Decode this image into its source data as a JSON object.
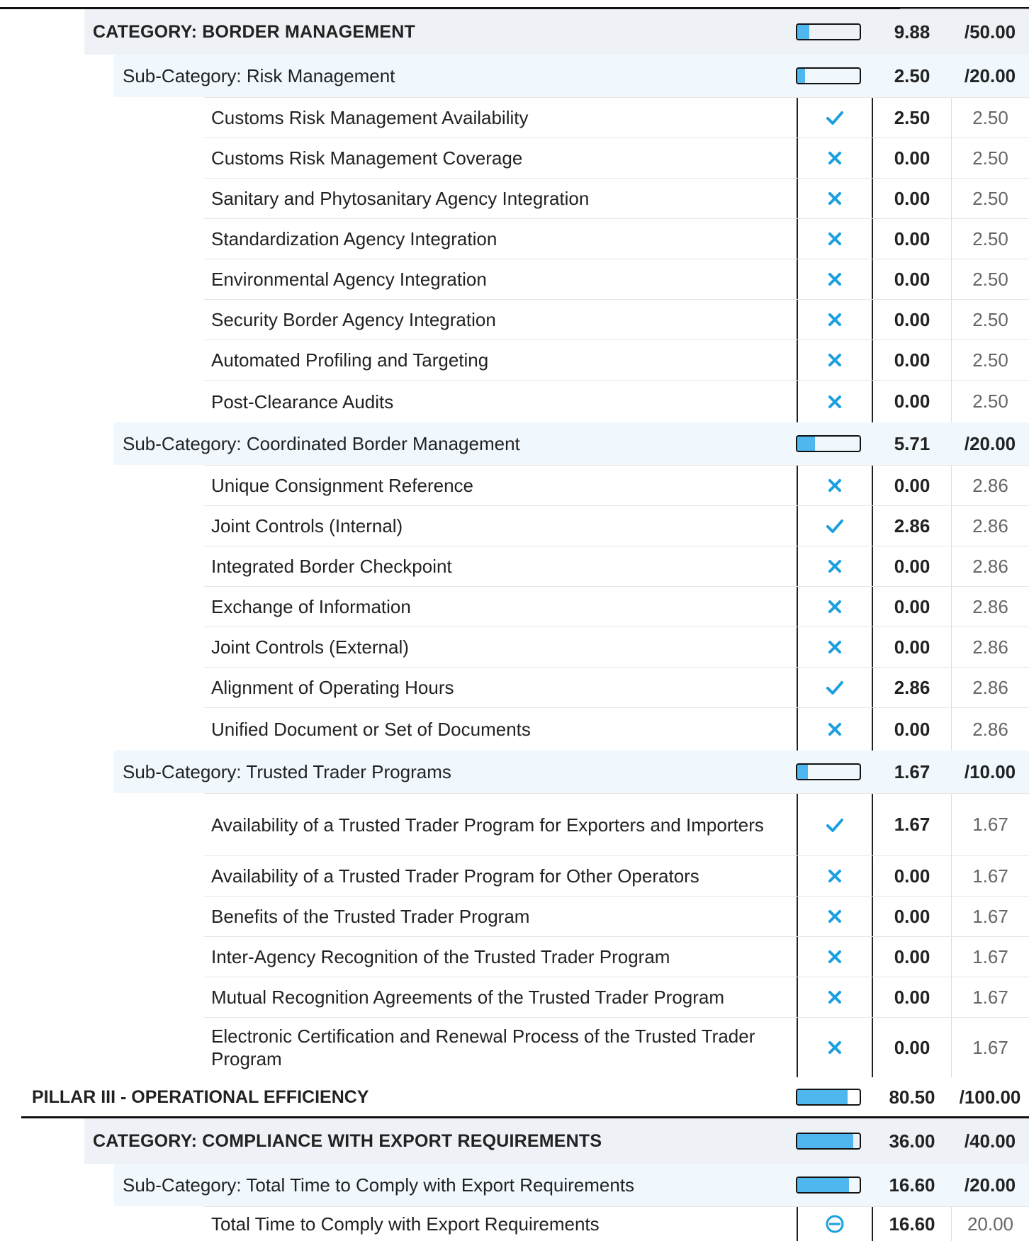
{
  "categories": [
    {
      "kind": "category",
      "label": "CATEGORY: BORDER MANAGEMENT",
      "score": "9.88",
      "max": "/50.00",
      "fill": 0.198
    },
    {
      "kind": "subcat",
      "label": "Sub-Category: Risk Management",
      "score": "2.50",
      "max": "/20.00",
      "fill": 0.125
    }
  ],
  "risk_items": [
    {
      "label": "Customs Risk Management Availability",
      "status": "check-icon",
      "score": "2.50",
      "max": "2.50"
    },
    {
      "label": "Customs Risk Management Coverage",
      "status": "cross-icon",
      "score": "0.00",
      "max": "2.50"
    },
    {
      "label": "Sanitary and Phytosanitary Agency Integration",
      "status": "cross-icon",
      "score": "0.00",
      "max": "2.50"
    },
    {
      "label": "Standardization Agency Integration",
      "status": "cross-icon",
      "score": "0.00",
      "max": "2.50"
    },
    {
      "label": "Environmental Agency Integration",
      "status": "cross-icon",
      "score": "0.00",
      "max": "2.50"
    },
    {
      "label": "Security Border Agency Integration",
      "status": "cross-icon",
      "score": "0.00",
      "max": "2.50"
    },
    {
      "label": "Automated Profiling and Targeting",
      "status": "cross-icon",
      "score": "0.00",
      "max": "2.50"
    },
    {
      "label": "Post-Clearance Audits",
      "status": "cross-icon",
      "score": "0.00",
      "max": "2.50"
    }
  ],
  "cbm": {
    "label": "Sub-Category: Coordinated Border Management",
    "score": "5.71",
    "max": "/20.00",
    "fill": 0.2855
  },
  "cbm_items": [
    {
      "label": "Unique Consignment Reference",
      "status": "cross-icon",
      "score": "0.00",
      "max": "2.86"
    },
    {
      "label": "Joint Controls (Internal)",
      "status": "check-icon",
      "score": "2.86",
      "max": "2.86"
    },
    {
      "label": "Integrated Border Checkpoint",
      "status": "cross-icon",
      "score": "0.00",
      "max": "2.86"
    },
    {
      "label": "Exchange of Information",
      "status": "cross-icon",
      "score": "0.00",
      "max": "2.86"
    },
    {
      "label": "Joint Controls (External)",
      "status": "cross-icon",
      "score": "0.00",
      "max": "2.86"
    },
    {
      "label": "Alignment of Operating Hours",
      "status": "check-icon",
      "score": "2.86",
      "max": "2.86"
    },
    {
      "label": "Unified Document or Set of Documents",
      "status": "cross-icon",
      "score": "0.00",
      "max": "2.86"
    }
  ],
  "ttp": {
    "label": "Sub-Category: Trusted Trader Programs",
    "score": "1.67",
    "max": "/10.00",
    "fill": 0.167
  },
  "ttp_items": [
    {
      "label": "Availability of a Trusted Trader Program for Exporters and Importers",
      "status": "check-icon",
      "score": "1.67",
      "max": "1.67"
    },
    {
      "label": "Availability of a Trusted Trader Program for Other Operators",
      "status": "cross-icon",
      "score": "0.00",
      "max": "1.67"
    },
    {
      "label": "Benefits of the Trusted Trader Program",
      "status": "cross-icon",
      "score": "0.00",
      "max": "1.67"
    },
    {
      "label": "Inter-Agency Recognition of the Trusted Trader Program",
      "status": "cross-icon",
      "score": "0.00",
      "max": "1.67"
    },
    {
      "label": "Mutual Recognition Agreements of the Trusted Trader Program",
      "status": "cross-icon",
      "score": "0.00",
      "max": "1.67"
    },
    {
      "label": "Electronic Certification and Renewal Process of the Trusted Trader Program",
      "status": "cross-icon",
      "score": "0.00",
      "max": "1.67"
    }
  ],
  "pillar": {
    "label": "PILLAR III - OPERATIONAL EFFICIENCY",
    "score": "80.50",
    "max": "/100.00",
    "fill": 0.805
  },
  "export_category": {
    "label": "CATEGORY: COMPLIANCE WITH EXPORT REQUIREMENTS",
    "score": "36.00",
    "max": "/40.00",
    "fill": 0.9
  },
  "export_subcat": {
    "label": "Sub-Category: Total Time to Comply with Export Requirements",
    "score": "16.60",
    "max": "/20.00",
    "fill": 0.83
  },
  "export_items": [
    {
      "label": "Total Time to Comply with Export Requirements",
      "status": "partial-icon",
      "score": "16.60",
      "max": "20.00"
    }
  ],
  "colors": {
    "accent": "#1a9fe0",
    "bar_fill": "#4fb6ef",
    "category_bg": "#eef2f7",
    "subcat_bg": "#f0f8fd"
  }
}
